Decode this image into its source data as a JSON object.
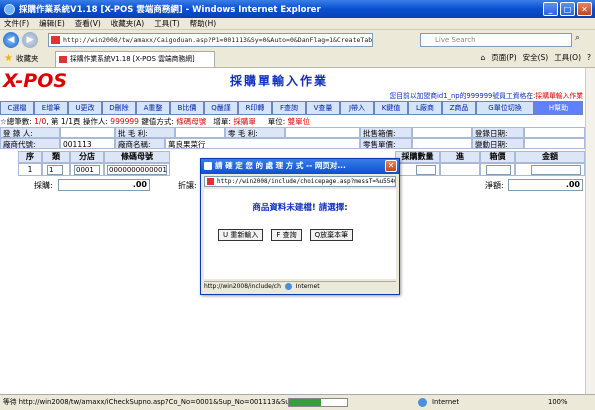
{
  "window": {
    "title": "採購作業系統V1.18 [X-POS 雲端商務網] - Windows Internet Explorer",
    "minimize": "_",
    "maximize": "□",
    "close": "✕"
  },
  "menu": [
    "文件(F)",
    "编辑(E)",
    "查看(V)",
    "收藏夹(A)",
    "工具(T)",
    "帮助(H)"
  ],
  "address_bar": {
    "url": "http://win2008/tw/amaxx/Caigoduan.asp?P1=001113&Sy=0&Auto=0&DanFlag=1&CreateTable=True",
    "search_placeholder": "Live Search"
  },
  "favorites": {
    "label": "收藏夹",
    "tab_title": "採購作業系統V1.18 [X-POS 雲端商務網]",
    "tools": [
      "页面(P)",
      "安全(S)",
      "工具(O)",
      "?"
    ]
  },
  "header": {
    "logo": "X-POS",
    "heading": "採購單輸入作業",
    "notice_prefix": "您目前以加盟商id1_np的999999號員工資格在:",
    "notice_suffix": "採購單輸入作業"
  },
  "function_buttons": [
    "C選檔",
    "E增筆",
    "U更改",
    "D刪除",
    "A重整",
    "B比價",
    "Q嚴謹",
    "R印轉",
    "F查詢",
    "V查量",
    "J帶入",
    "K鍵值",
    "L廠商",
    "Z商品",
    "G單位切換",
    "H幫助"
  ],
  "info_line": {
    "total_label": "☆總筆數:",
    "total_value": "1/0",
    "page_text": "第 1/1頁",
    "operator_label": "操作人:",
    "operator_value": "999999",
    "keymode_label": "鍵值方式:",
    "keymode_value": "條碼母號",
    "increment_label": "增單:",
    "increment_value": "採購單",
    "unit_label": "單位:",
    "unit_value": "雙單位"
  },
  "form": {
    "registrar_label": "登 錄 人:",
    "batch_profit_label": "批 毛 利:",
    "retail_profit_label": "零 毛 利:",
    "batch_box_label": "批售箱價:",
    "login_date_label": "登錄日期:",
    "vendor_code_label": "廠商代號:",
    "vendor_code_value": "001113",
    "vendor_name_label": "廠商名稱:",
    "vendor_name_value": "萬良果菜行",
    "retail_price_label": "零售單價:",
    "change_date_label": "變動日期:"
  },
  "table": {
    "columns": [
      "序",
      "類",
      "分店",
      "條碼母號",
      "採購數量",
      "進",
      "箱價",
      "金額"
    ],
    "rows": [
      {
        "seq": "1",
        "type": "1",
        "branch": "0001",
        "barcode": "0000000000001"
      }
    ]
  },
  "totals": {
    "purchase_label": "採購:",
    "purchase_value": ".00",
    "discount_label": "折讓:",
    "net_label": "淨額:",
    "net_value": ".00"
  },
  "dialog": {
    "title": "請 確 定 您 的 處 理 方 式 -- 网页对...",
    "url": "http://win2008/include/choicepage.asp?messT=%u5546",
    "message": "商品資料未建檔! 請選擇:",
    "buttons": [
      "U 重新輸入",
      "F 查詢",
      "Q放棄本筆"
    ],
    "status_url": "http://win2008/include/ch",
    "status_zone": "Internet"
  },
  "statusbar": {
    "text": "等待 http://win2008/tw/amaxx/iCheckSupno.asp?Co_No=0001&Sup_No=001113&SubNo=000",
    "progress": 0.55,
    "zone": "Internet",
    "zoom": "100%"
  }
}
